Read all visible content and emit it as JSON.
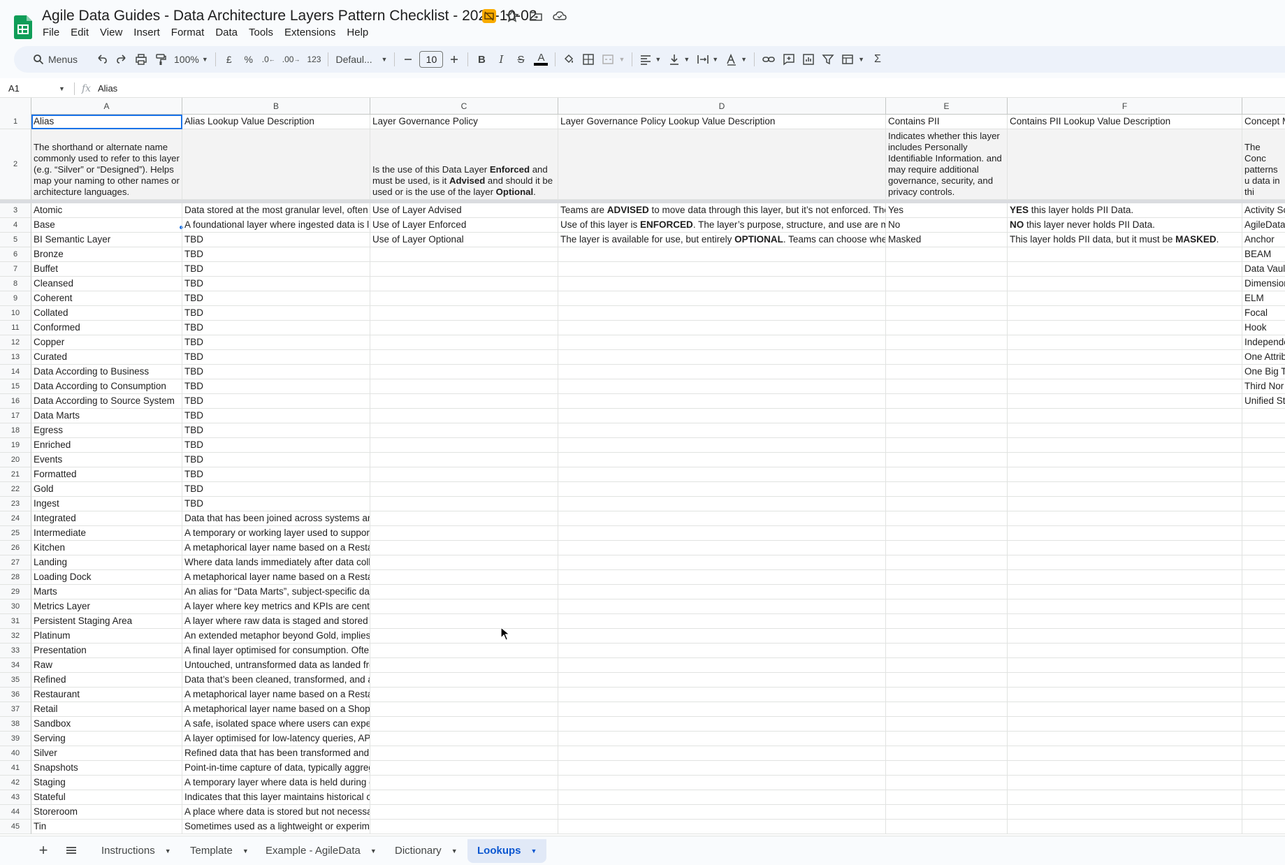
{
  "title": "Agile Data Guides - Data Architecture Layers Pattern Checklist - 2025-10-02",
  "menu": [
    "File",
    "Edit",
    "View",
    "Insert",
    "Format",
    "Data",
    "Tools",
    "Extensions",
    "Help"
  ],
  "toolbar": {
    "search_label": "Menus",
    "zoom": "100%",
    "currency": "£",
    "percent": "%",
    "dec_decrease": ".0",
    "dec_increase": ".00",
    "format_123": "123",
    "font": "Defaul...",
    "font_size": "10",
    "bold": "B",
    "italic": "I",
    "strike": "S",
    "text_color": "A",
    "sigma": "Σ"
  },
  "formula_bar": {
    "cell_ref": "A1",
    "fx": "fx",
    "value": "Alias"
  },
  "columns": [
    "A",
    "B",
    "C",
    "D",
    "E",
    "F"
  ],
  "header_row": {
    "num": "1",
    "a": "Alias",
    "b": "Alias Lookup Value Description",
    "c": "Layer Governance Policy",
    "d": "Layer Governance Policy Lookup Value Description",
    "e": "Contains PII",
    "f": "Contains PII Lookup Value Description",
    "g": "Concept M"
  },
  "desc_row": {
    "num": "2",
    "a": "The shorthand or alternate name commonly used to refer to this layer (e.g. “Silver” or “Designed”). Helps map your naming to other names or architecture languages.",
    "c_1": "Is the use of this Data Layer ",
    "c_2": "Enforced",
    "c_3": " and must be used, is it ",
    "c_4": "Advised",
    "c_5": " and should it be used or is the use of the layer ",
    "c_6": "Optional",
    "c_7": ".",
    "e": "Indicates whether this layer includes Personally Identifiable Information. and may require additional governance, security, and privacy controls.",
    "g": "The Conc patterns u data in thi"
  },
  "rows": [
    {
      "num": "3",
      "a": "Atomic",
      "b": "Data stored at the most granular level, often used",
      "c": "Use of Layer Advised",
      "d1": "Teams are ",
      "d2": "ADVISED",
      "d3": " to move data through this layer, but it’s not enforced. The",
      "e": "Yes",
      "f1": "YES",
      "f2": " this layer holds PII Data.",
      "g": "Activity Sc"
    },
    {
      "num": "4",
      "a": "Base",
      "b": "A foundational layer where ingested data is lightly",
      "c": "Use of Layer Enforced",
      "d1": "Use of this layer is ",
      "d2": "ENFORCED",
      "d3": ". The layer’s purpose, structure, and use are m",
      "e": "No",
      "f1": "NO",
      "f2": " this layer never holds PII Data.",
      "g": "AgileData"
    },
    {
      "num": "5",
      "a": "BI Semantic Layer",
      "b": "TBD",
      "c": "Use of Layer Optional",
      "d1": "The layer is available for use, but entirely ",
      "d2": "OPTIONAL",
      "d3": ". Teams can choose whet",
      "e": "Masked",
      "f1": "This layer holds PII data, but it must be ",
      "f2": "MASKED",
      "f3": ".",
      "g": "Anchor"
    },
    {
      "num": "6",
      "a": "Bronze",
      "b": "TBD",
      "g": "BEAM"
    },
    {
      "num": "7",
      "a": "Buffet",
      "b": "TBD",
      "g": "Data Vaul"
    },
    {
      "num": "8",
      "a": "Cleansed",
      "b": "TBD",
      "g": "Dimension"
    },
    {
      "num": "9",
      "a": "Coherent",
      "b": "TBD",
      "g": "ELM"
    },
    {
      "num": "10",
      "a": "Collated",
      "b": "TBD",
      "g": "Focal"
    },
    {
      "num": "11",
      "a": "Conformed",
      "b": "TBD",
      "g": "Hook"
    },
    {
      "num": "12",
      "a": "Copper",
      "b": "TBD",
      "g": "Independe"
    },
    {
      "num": "13",
      "a": "Curated",
      "b": "TBD",
      "g": "One Attrib"
    },
    {
      "num": "14",
      "a": "Data According to Business",
      "b": "TBD",
      "g": "One Big T"
    },
    {
      "num": "15",
      "a": "Data According to Consumption",
      "b": "TBD",
      "g": "Third Nor"
    },
    {
      "num": "16",
      "a": "Data According to Source System",
      "b": "TBD",
      "g": "Unified St"
    },
    {
      "num": "17",
      "a": "Data Marts",
      "b": "TBD"
    },
    {
      "num": "18",
      "a": "Egress",
      "b": "TBD"
    },
    {
      "num": "19",
      "a": "Enriched",
      "b": "TBD"
    },
    {
      "num": "20",
      "a": "Events",
      "b": "TBD"
    },
    {
      "num": "21",
      "a": "Formatted",
      "b": "TBD"
    },
    {
      "num": "22",
      "a": "Gold",
      "b": "TBD"
    },
    {
      "num": "23",
      "a": "Ingest",
      "b": "TBD"
    },
    {
      "num": "24",
      "a": "Integrated",
      "b": "Data that has been joined across systems and"
    },
    {
      "num": "25",
      "a": "Intermediate",
      "b": "A temporary or working layer used to support"
    },
    {
      "num": "26",
      "a": "Kitchen",
      "b": "A metaphorical layer name based on a Restaurant"
    },
    {
      "num": "27",
      "a": "Landing",
      "b": "Where data lands immediately after data collection"
    },
    {
      "num": "28",
      "a": "Loading Dock",
      "b": "A metaphorical layer name based on a Restaurant"
    },
    {
      "num": "29",
      "a": "Marts",
      "b": "An alias for “Data Marts”, subject-specific data"
    },
    {
      "num": "30",
      "a": "Metrics Layer",
      "b": "A layer where key metrics and KPIs are centrally"
    },
    {
      "num": "31",
      "a": "Persistent Staging Area",
      "b": "A layer where raw data is staged and stored persistently"
    },
    {
      "num": "32",
      "a": "Platinum",
      "b": "An extended metaphor beyond Gold, implies"
    },
    {
      "num": "33",
      "a": "Presentation",
      "b": "A final layer optimised for consumption. Often"
    },
    {
      "num": "34",
      "a": "Raw",
      "b": "Untouched, untransformed data as landed from"
    },
    {
      "num": "35",
      "a": "Refined",
      "b": "Data that’s been cleaned, transformed, and aligned"
    },
    {
      "num": "36",
      "a": "Restaurant",
      "b": "A metaphorical layer name based on a Restaurant"
    },
    {
      "num": "37",
      "a": "Retail",
      "b": "A metaphorical layer name based on a Shop,"
    },
    {
      "num": "38",
      "a": "Sandbox",
      "b": "A safe, isolated space where users can experiment"
    },
    {
      "num": "39",
      "a": "Serving",
      "b": "A layer optimised for low-latency queries, APIs"
    },
    {
      "num": "40",
      "a": "Silver",
      "b": "Refined data that has been transformed and"
    },
    {
      "num": "41",
      "a": "Snapshots",
      "b": "Point-in-time capture of data, typically aggregated"
    },
    {
      "num": "42",
      "a": "Staging",
      "b": "A temporary layer where data is held during data"
    },
    {
      "num": "43",
      "a": "Stateful",
      "b": "Indicates that this layer maintains historical changes"
    },
    {
      "num": "44",
      "a": "Storeroom",
      "b": "A place where data is stored but not necessarily"
    },
    {
      "num": "45",
      "a": "Tin",
      "b": "Sometimes used as a lightweight or experimental"
    }
  ],
  "sheet_tabs": [
    {
      "label": "Instructions",
      "active": false
    },
    {
      "label": "Template",
      "active": false
    },
    {
      "label": "Example - AgileData",
      "active": false
    },
    {
      "label": "Dictionary",
      "active": false
    },
    {
      "label": "Lookups",
      "active": true
    }
  ],
  "colors": {
    "accent": "#1a73e8",
    "sheets_green": "#0f9d58",
    "tab_active_bg": "#e1e9f7",
    "tab_active_text": "#0b57d0",
    "badge": "#f9ab00"
  }
}
